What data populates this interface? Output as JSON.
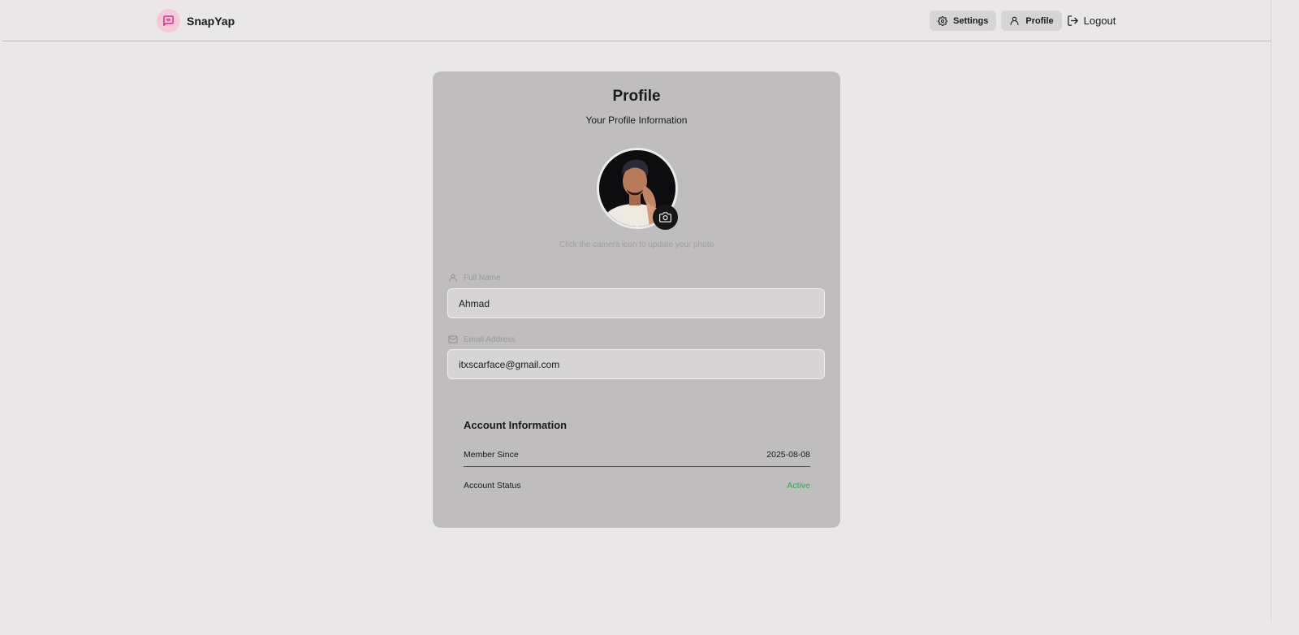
{
  "app": {
    "name": "SnapYap"
  },
  "nav": {
    "settings_label": "Settings",
    "profile_label": "Profile",
    "logout_label": "Logout"
  },
  "profile": {
    "title": "Profile",
    "subtitle": "Your Profile Information",
    "photo_hint": "Click the camera icon to update your photo",
    "full_name_label": "Full Name",
    "full_name_value": "Ahmad",
    "email_label": "Email Address",
    "email_value": "itxscarface@gmail.com"
  },
  "account": {
    "title": "Account Information",
    "member_since_label": "Member Since",
    "member_since_value": "2025-08-08",
    "status_label": "Account Status",
    "status_value": "Active"
  },
  "colors": {
    "accent": "#e91e78",
    "status_active": "#26b04e",
    "card_bg": "#bfbdbe",
    "page_bg": "#e9e7e8"
  },
  "icons": {
    "brand": "message-square-icon",
    "settings": "gear-icon",
    "profile": "user-icon",
    "logout": "logout-icon",
    "camera": "camera-icon",
    "full_name": "user-icon",
    "email": "mail-icon"
  }
}
